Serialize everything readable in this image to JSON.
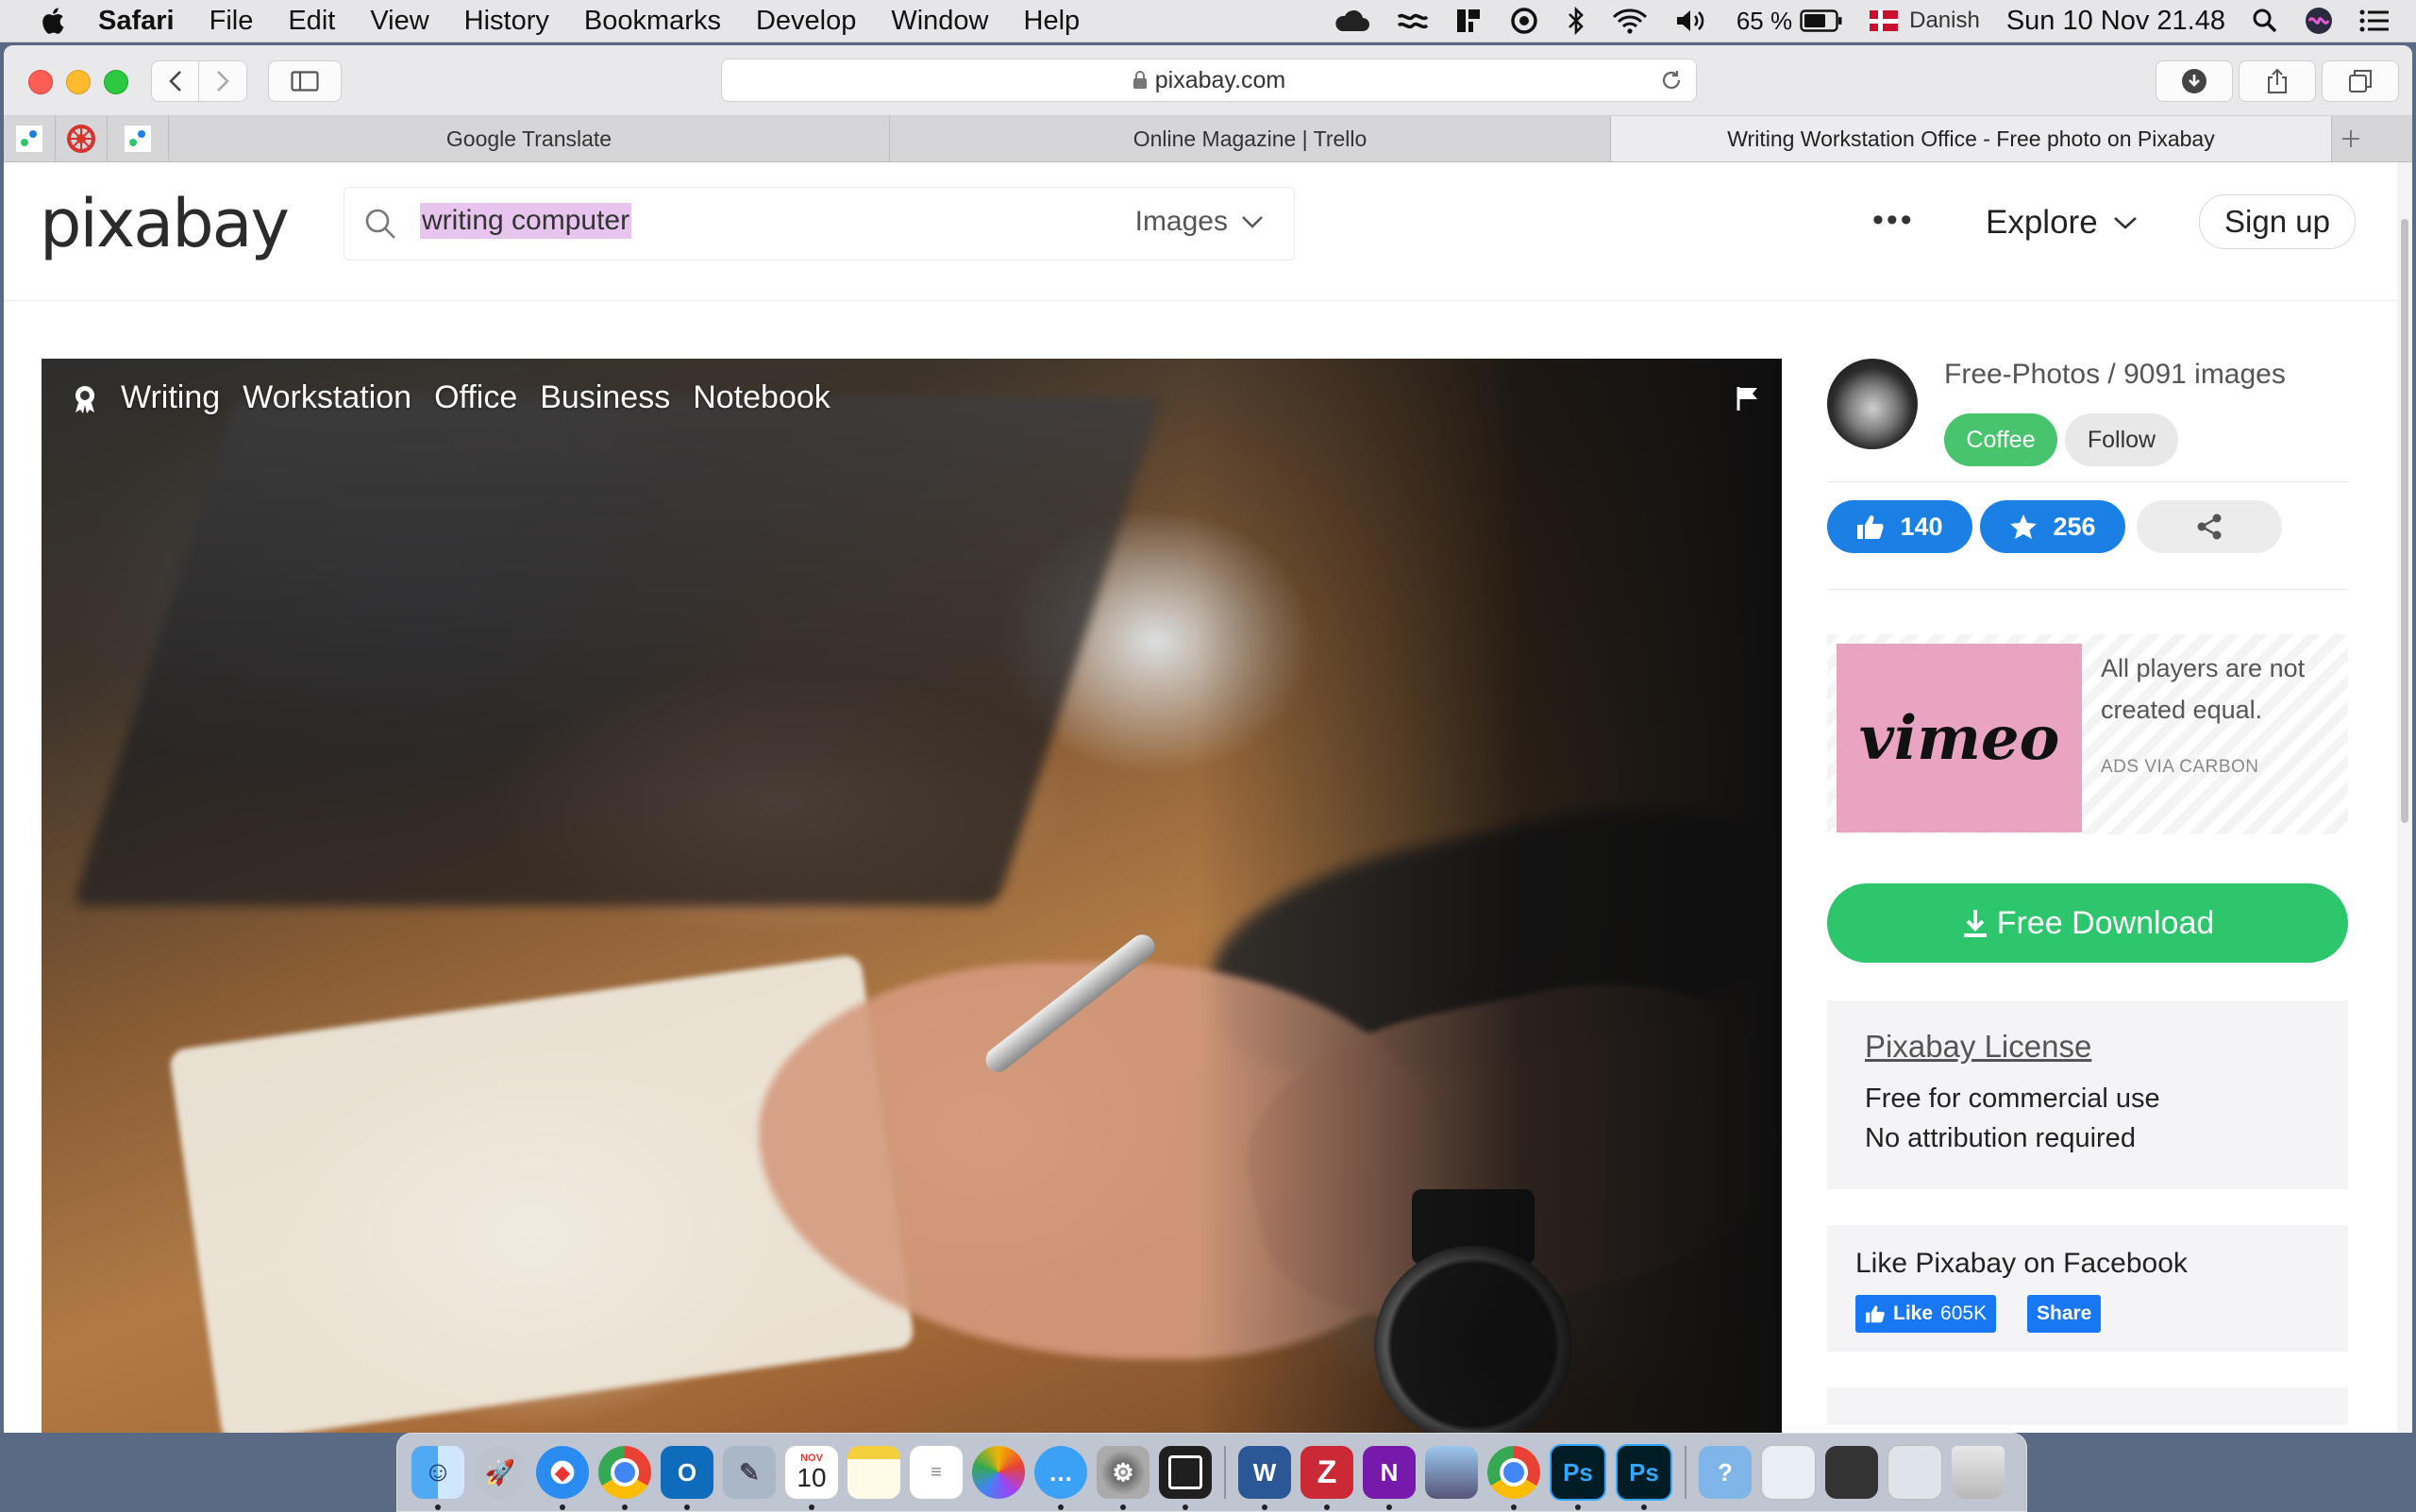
{
  "menubar": {
    "app": "Safari",
    "items": [
      "File",
      "Edit",
      "View",
      "History",
      "Bookmarks",
      "Develop",
      "Window",
      "Help"
    ],
    "battery": "65 %",
    "input_source": "Danish",
    "clock": "Sun 10 Nov  21.48"
  },
  "browser": {
    "url": "pixabay.com",
    "tabs": [
      {
        "label": "Google Translate"
      },
      {
        "label": "Online Magazine | Trello"
      },
      {
        "label": "Writing Workstation Office - Free photo on Pixabay"
      }
    ]
  },
  "site": {
    "logo": "pixabay",
    "search": {
      "value": "writing computer",
      "type": "Images"
    },
    "nav": {
      "explore": "Explore",
      "signup": "Sign up"
    }
  },
  "photo": {
    "tags": [
      "Writing",
      "Workstation",
      "Office",
      "Business",
      "Notebook"
    ]
  },
  "sidebar": {
    "author": "Free-Photos / 9091 images",
    "coffee": "Coffee",
    "follow": "Follow",
    "likes": "140",
    "favorites": "256",
    "ad": {
      "brand": "vimeo",
      "text": "All players are not created equal.",
      "via": "ADS VIA CARBON"
    },
    "download": "Free Download",
    "license": {
      "title": "Pixabay License",
      "line1": "Free for commercial use",
      "line2": "No attribution required"
    },
    "facebook": {
      "title": "Like Pixabay on Facebook",
      "like": "Like",
      "like_count": "605K",
      "share": "Share"
    }
  },
  "colors": {
    "download_green": "#2ec66d",
    "coffee_green": "#48c46c",
    "like_blue": "#1b80e3",
    "facebook_blue": "#1877f2"
  },
  "dock": {
    "calendar_date": "10",
    "calendar_month": "NOV",
    "apps": [
      "finder-icon",
      "launchpad-icon",
      "safari-icon",
      "chrome-icon",
      "outlook-icon",
      "preview-icon",
      "calendar-icon",
      "notes-icon",
      "reminders-icon",
      "photos-icon",
      "messages-icon",
      "system-preferences-icon",
      "trello-icon",
      "word-icon",
      "zotero-icon",
      "onenote-icon",
      "image-capture-icon",
      "chrome-icon",
      "photoshop-icon",
      "photoshop-icon",
      "help-icon",
      "downloads-stack-icon",
      "documents-stack-icon",
      "screenshots-stack-icon",
      "trash-icon"
    ]
  }
}
